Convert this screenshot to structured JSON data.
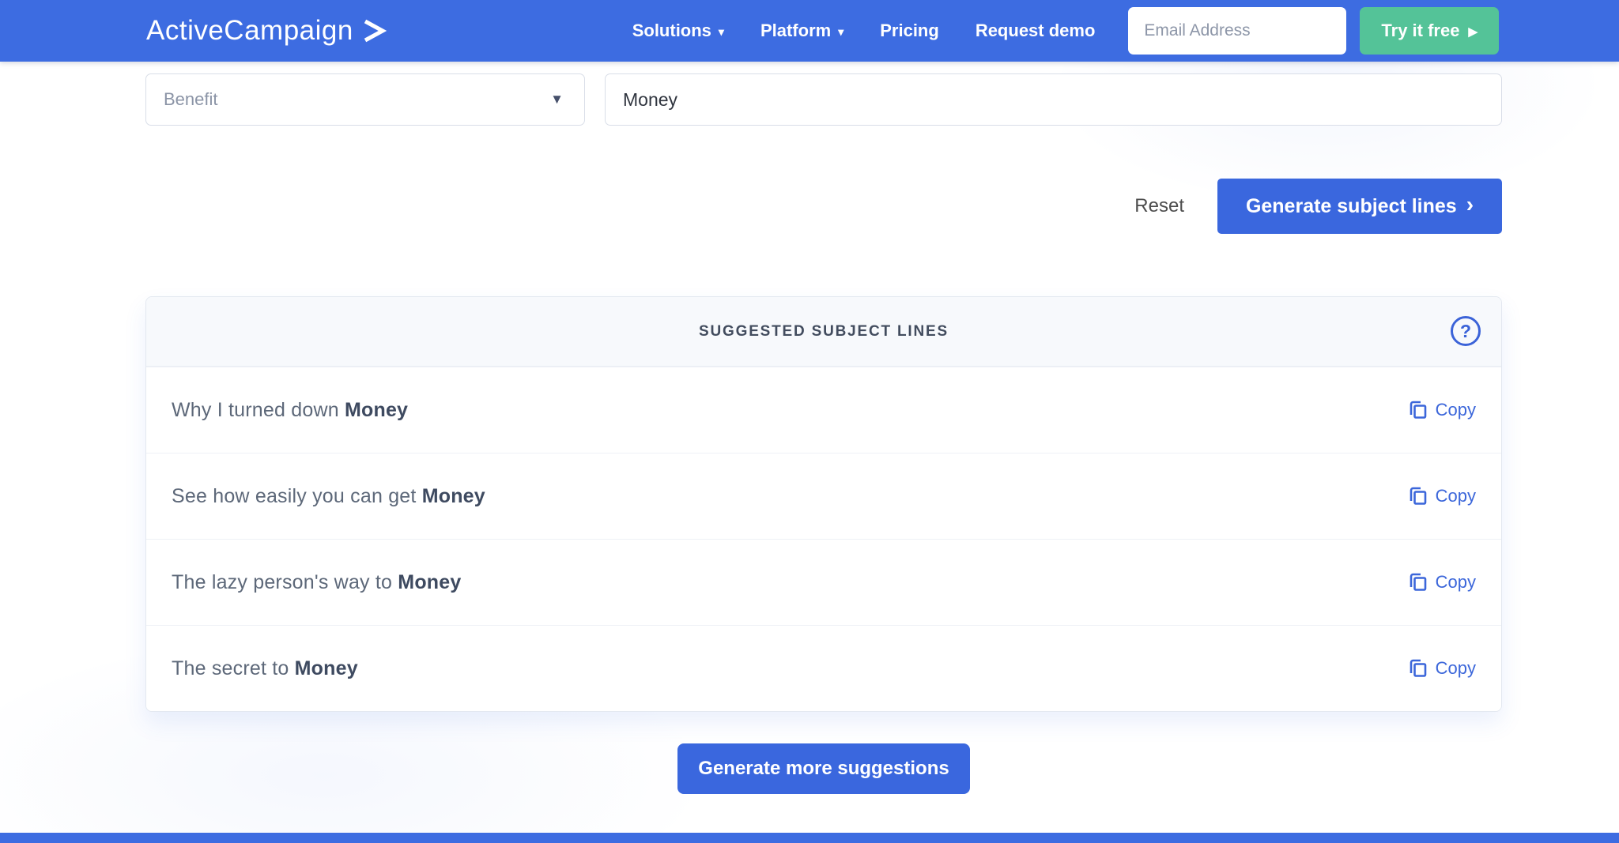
{
  "navbar": {
    "logo_text": "ActiveCampaign",
    "links": [
      {
        "label": "Solutions",
        "caret": "▾"
      },
      {
        "label": "Platform",
        "caret": "▾"
      },
      {
        "label": "Pricing"
      },
      {
        "label": "Request demo"
      }
    ],
    "email_placeholder": "Email Address",
    "cta_label": "Try it free",
    "cta_arrow": "▶"
  },
  "form": {
    "category_value": "Benefit",
    "category_caret": "▼",
    "keyword_value": "Money",
    "reset_label": "Reset",
    "generate_label": "Generate subject lines",
    "generate_arrow": "›"
  },
  "results": {
    "header": "SUGGESTED SUBJECT LINES",
    "help_glyph": "?",
    "copy_label": "Copy",
    "items": [
      {
        "prefix": "Why I turned down ",
        "keyword": "Money"
      },
      {
        "prefix": "See how easily you can get ",
        "keyword": "Money"
      },
      {
        "prefix": "The lazy person's way to ",
        "keyword": "Money"
      },
      {
        "prefix": "The secret to ",
        "keyword": "Money"
      }
    ]
  },
  "footer": {
    "more_button_label": "Generate more suggestions"
  },
  "colors": {
    "navbar_blue": "#3d6ce1",
    "button_blue": "#3a67de",
    "cta_green": "#54c398",
    "copy_link_blue": "#3b66da",
    "panel_header_bg": "#f7f9fc",
    "row_text_gray": "#5d6879",
    "keyword_dark": "#3e4a60"
  }
}
